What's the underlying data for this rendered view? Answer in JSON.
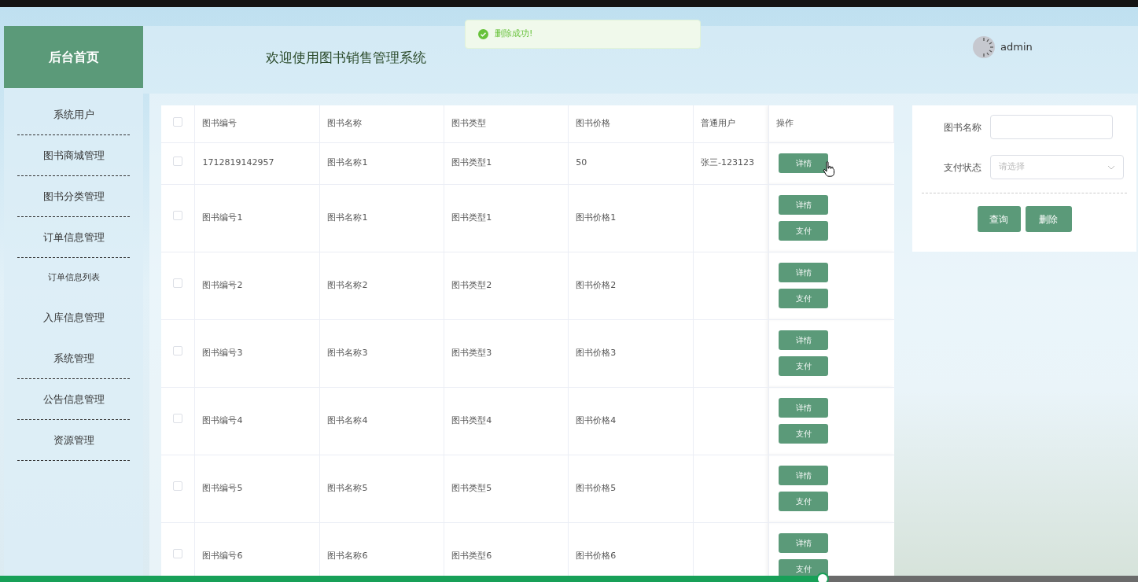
{
  "toast": {
    "kind": "success",
    "text": "删除成功!"
  },
  "sidebar": {
    "home": "后台首页",
    "items": [
      {
        "label": "系统用户",
        "kind": "group",
        "underlined": true
      },
      {
        "label": "图书商城管理",
        "kind": "group",
        "underlined": true
      },
      {
        "label": "图书分类管理",
        "kind": "group",
        "underlined": true
      },
      {
        "label": "订单信息管理",
        "kind": "group",
        "underlined": true
      },
      {
        "label": "订单信息列表",
        "kind": "sub",
        "underlined": false
      },
      {
        "label": "入库信息管理",
        "kind": "group",
        "underlined": false
      },
      {
        "label": "系统管理",
        "kind": "group",
        "underlined": true
      },
      {
        "label": "公告信息管理",
        "kind": "group",
        "underlined": true
      },
      {
        "label": "资源管理",
        "kind": "group",
        "underlined": true
      }
    ]
  },
  "header": {
    "title": "欢迎使用图书销售管理系统",
    "user": "admin"
  },
  "table": {
    "select_all": {
      "checked": false
    },
    "columns": [
      "图书编号",
      "图书名称",
      "图书类型",
      "图书价格",
      "普通用户",
      "操作"
    ],
    "rows": [
      {
        "checked": false,
        "cells": [
          "1712819142957",
          "图书名称1",
          "图书类型1",
          "50",
          "张三-123123"
        ],
        "actions": [
          "详情"
        ]
      },
      {
        "checked": false,
        "cells": [
          "图书编号1",
          "图书名称1",
          "图书类型1",
          "图书价格1",
          ""
        ],
        "actions": [
          "详情",
          "支付"
        ]
      },
      {
        "checked": false,
        "cells": [
          "图书编号2",
          "图书名称2",
          "图书类型2",
          "图书价格2",
          ""
        ],
        "actions": [
          "详情",
          "支付"
        ]
      },
      {
        "checked": false,
        "cells": [
          "图书编号3",
          "图书名称3",
          "图书类型3",
          "图书价格3",
          ""
        ],
        "actions": [
          "详情",
          "支付"
        ]
      },
      {
        "checked": false,
        "cells": [
          "图书编号4",
          "图书名称4",
          "图书类型4",
          "图书价格4",
          ""
        ],
        "actions": [
          "详情",
          "支付"
        ]
      },
      {
        "checked": false,
        "cells": [
          "图书编号5",
          "图书名称5",
          "图书类型5",
          "图书价格5",
          ""
        ],
        "actions": [
          "详情",
          "支付"
        ]
      },
      {
        "checked": false,
        "cells": [
          "图书编号6",
          "图书名称6",
          "图书类型6",
          "图书价格6",
          ""
        ],
        "actions": [
          "详情",
          "支付"
        ]
      }
    ]
  },
  "search": {
    "fields": [
      {
        "kind": "input",
        "label": "图书名称"
      },
      {
        "kind": "select",
        "label": "支付状态",
        "placeholder": "请选择"
      }
    ],
    "buttons": [
      "查询",
      "删除"
    ]
  },
  "player": {
    "level": 0.723
  }
}
